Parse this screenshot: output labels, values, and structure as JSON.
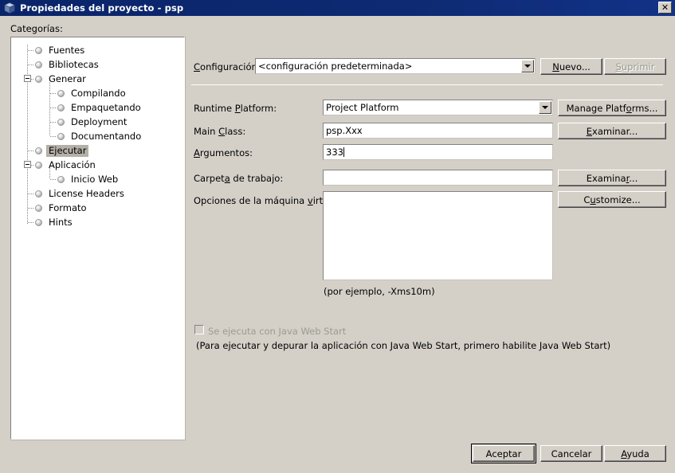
{
  "window": {
    "title": "Propiedades del proyecto - psp",
    "icon": "project-cube-icon",
    "close_label": "✕",
    "titlebar_color": "#0a246a",
    "face_color": "#d4d0c8"
  },
  "categories": {
    "label": "Categorías:",
    "selected": "Ejecutar",
    "items": [
      {
        "label": "Fuentes",
        "level": 1,
        "expander": null
      },
      {
        "label": "Bibliotecas",
        "level": 1,
        "expander": null
      },
      {
        "label": "Generar",
        "level": 1,
        "expander": "minus"
      },
      {
        "label": "Compilando",
        "level": 2,
        "expander": null
      },
      {
        "label": "Empaquetando",
        "level": 2,
        "expander": null
      },
      {
        "label": "Deployment",
        "level": 2,
        "expander": null
      },
      {
        "label": "Documentando",
        "level": 2,
        "expander": null
      },
      {
        "label": "Ejecutar",
        "level": 1,
        "expander": null
      },
      {
        "label": "Aplicación",
        "level": 1,
        "expander": "minus"
      },
      {
        "label": "Inicio Web",
        "level": 2,
        "expander": null
      },
      {
        "label": "License Headers",
        "level": 1,
        "expander": null
      },
      {
        "label": "Formato",
        "level": 1,
        "expander": null
      },
      {
        "label": "Hints",
        "level": 1,
        "expander": null
      }
    ]
  },
  "form": {
    "configuration": {
      "label_pre": "",
      "label_mnemonic": "C",
      "label_post": "onfiguración:",
      "value": "<configuración predeterminada>"
    },
    "new_button": {
      "pre": "",
      "mnemonic": "N",
      "post": "uevo..."
    },
    "delete_button": {
      "pre": "",
      "mnemonic": "S",
      "post": "uprimir",
      "disabled": true
    },
    "runtime_platform": {
      "label_pre": "Runtime ",
      "label_mnemonic": "P",
      "label_post": "latform:",
      "value": "Project Platform"
    },
    "manage_platforms_button": {
      "pre": "Manage Platf",
      "mnemonic": "o",
      "post": "rms..."
    },
    "main_class": {
      "label_pre": "Main ",
      "label_mnemonic": "C",
      "label_post": "lass:",
      "value": "psp.Xxx"
    },
    "browse_main_class_button": {
      "pre": "",
      "mnemonic": "E",
      "post": "xaminar..."
    },
    "arguments": {
      "label_pre": "",
      "label_mnemonic": "A",
      "label_post": "rgumentos:",
      "value": "333",
      "has_caret": true
    },
    "working_dir": {
      "label_pre": "Carpet",
      "label_mnemonic": "a",
      "label_post": " de trabajo:",
      "value": ""
    },
    "browse_working_dir_button": {
      "pre": "Examina",
      "mnemonic": "r",
      "post": "..."
    },
    "vm_options": {
      "label_pre": "Opciones de la máquina ",
      "label_mnemonic": "v",
      "label_post": "irtual:",
      "value": ""
    },
    "customize_button": {
      "pre": "C",
      "mnemonic": "u",
      "post": "stomize..."
    },
    "vm_hint": "(por ejemplo, -Xms10m)",
    "web_start_checkbox": {
      "label": "Se ejecuta con Java Web Start",
      "checked": false,
      "disabled": true
    },
    "web_start_note": "(Para ejecutar y depurar la aplicación con Java Web Start, primero habilite Java Web Start)"
  },
  "footer": {
    "ok_button": "Aceptar",
    "cancel_button": "Cancelar",
    "help_button": {
      "pre": "",
      "mnemonic": "A",
      "post": "yuda"
    }
  }
}
